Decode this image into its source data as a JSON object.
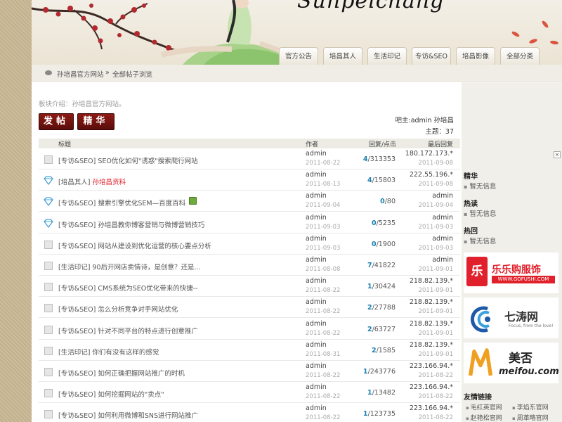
{
  "header": {
    "logo": "Sunpeichang"
  },
  "nav": {
    "tabs": [
      "官方公告",
      "培昌其人",
      "生活印记",
      "专访&SEO",
      "培昌影像",
      "全部分类"
    ]
  },
  "breadcrumb": {
    "site": "孙培昌官方网站",
    "sep": "»",
    "current": "全部帖子浏览"
  },
  "board": {
    "intro": "板块介绍：孙培昌官方网站。",
    "post_button": "发帖",
    "digest_button": "精华",
    "moderator": "吧主:admin 孙培昌",
    "topics": "主题：37"
  },
  "table": {
    "headers": {
      "title": "标题",
      "author": "作者",
      "replies": "回复/点击",
      "last": "最后回复"
    },
    "rows": [
      {
        "icon": "doc",
        "title": "[专访&SEO] SEO优化如何\"诱惑\"搜索爬行网站",
        "author": "admin",
        "date": "2011-08-22",
        "reply": "4",
        "views": "/313353",
        "last": "180.172.173.*",
        "lastdate": "2011-09-08"
      },
      {
        "icon": "diamond",
        "title_prefix": "[培昌其人]",
        "title": "孙培昌资料",
        "red": true,
        "author": "admin",
        "date": "2011-08-13",
        "reply": "4",
        "views": "/15803",
        "last": "222.55.196.*",
        "lastdate": "2011-09-08"
      },
      {
        "icon": "diamond",
        "title": "[专访&SEO] 搜索引擎优化SEM—百度百科",
        "attach": true,
        "author": "admin",
        "date": "2011-09-04",
        "reply": "0",
        "views": "/80",
        "last": "admin",
        "lastdate": "2011-09-04"
      },
      {
        "icon": "diamond",
        "title": "[专访&SEO] 孙培昌教你博客营销与微博营销技巧",
        "author": "admin",
        "date": "2011-09-03",
        "reply": "0",
        "views": "/5235",
        "last": "admin",
        "lastdate": "2011-09-03"
      },
      {
        "icon": "doc",
        "title": "[专访&SEO] 网站从建设到优化运营的核心要点分析",
        "author": "admin",
        "date": "2011-09-03",
        "reply": "0",
        "views": "/1900",
        "last": "admin",
        "lastdate": "2011-09-03"
      },
      {
        "icon": "doc",
        "title": "[生活印记] 90后开网店卖情诗，是创意？还是...",
        "author": "admin",
        "date": "2011-08-08",
        "reply": "7",
        "views": "/41822",
        "last": "admin",
        "lastdate": "2011-09-01"
      },
      {
        "icon": "doc",
        "title": "[专访&SEO] CMS系统为SEO优化带来的快捷--",
        "author": "admin",
        "date": "2011-08-22",
        "reply": "1",
        "views": "/30424",
        "last": "218.82.139.*",
        "lastdate": "2011-09-01"
      },
      {
        "icon": "doc",
        "title": "[专访&SEO] 怎么分析竞争对手网站优化",
        "author": "admin",
        "date": "2011-08-22",
        "reply": "2",
        "views": "/27788",
        "last": "218.82.139.*",
        "lastdate": "2011-09-01"
      },
      {
        "icon": "doc",
        "title": "[专访&SEO] 针对不同平台的特点进行创意推广",
        "author": "admin",
        "date": "2011-08-22",
        "reply": "2",
        "views": "/63727",
        "last": "218.82.139.*",
        "lastdate": "2011-09-01"
      },
      {
        "icon": "doc",
        "title": "[生活印记] 你们有没有这样的感觉",
        "author": "admin",
        "date": "2011-08-31",
        "reply": "2",
        "views": "/1585",
        "last": "218.82.139.*",
        "lastdate": "2011-09-01"
      },
      {
        "icon": "doc",
        "title": "[专访&SEO] 如何正确把握网站推广的时机",
        "author": "admin",
        "date": "2011-08-22",
        "reply": "1",
        "views": "/243776",
        "last": "223.166.94.*",
        "lastdate": "2011-08-22"
      },
      {
        "icon": "doc",
        "title": "[专访&SEO] 如何挖掘网站的\"卖点\"",
        "author": "admin",
        "date": "2011-08-22",
        "reply": "1",
        "views": "/13482",
        "last": "223.166.94.*",
        "lastdate": "2011-08-22"
      },
      {
        "icon": "doc",
        "title": "[专访&SEO] 如何利用微博和SNS进行网站推广",
        "author": "admin",
        "date": "2011-08-22",
        "reply": "1",
        "views": "/123735",
        "last": "223.166.94.*",
        "lastdate": "2011-08-22"
      }
    ]
  },
  "sidebar": {
    "scroll_glyph": "×",
    "digest_title": "精华",
    "digest_item": "暂无信息",
    "hot_title": "热读",
    "hot_item": "暂无信息",
    "reply_title": "热回",
    "reply_item": "暂无信息",
    "ad1": {
      "name": "乐乐购服饰",
      "url": "WWW.GOFUSHI.COM",
      "bag_text": "乐"
    },
    "ad2": {
      "name": "七涛网",
      "slogan": "Focus, from the love!"
    },
    "ad3": {
      "name": "美否",
      "url": "meifou.com"
    },
    "links_title": "友情链接",
    "links": [
      "毛红英官网",
      "李焰东官网",
      "赵艳松官网",
      "周革略官网"
    ]
  },
  "colors": {
    "accent_red": "#8d1a14",
    "reply_blue": "#1a7fb0",
    "diamond_blue": "#4aa3d8",
    "red_title": "#e0202a"
  }
}
